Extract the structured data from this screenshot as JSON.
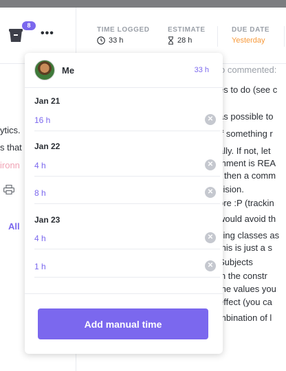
{
  "header": {
    "badge_count": "8",
    "more_label": "•••",
    "time_logged": {
      "label": "TIME LOGGED",
      "value": "33 h"
    },
    "estimate": {
      "label": "ESTIMATE",
      "value": "28 h"
    },
    "due_date": {
      "label": "DUE DATE",
      "value": "Yesterday"
    }
  },
  "left_fragments": [
    "ytics.",
    "s that",
    "ironn"
  ],
  "all_link": "All",
  "comments": [
    {
      "text": "o commented:",
      "style": "grey"
    },
    {
      "text": "es to do (see c",
      "style": "normal"
    },
    {
      "text": "as possible to",
      "style": "normal"
    },
    {
      "text": "If something r",
      "style": "normal"
    },
    {
      "text": "ally. If not, let",
      "style": "normal"
    },
    {
      "text": "mment is REA",
      "style": "normal"
    },
    {
      "text": ") then a comm",
      "style": "normal"
    },
    {
      "text": "cision.",
      "style": "normal"
    },
    {
      "text": "ore :P (trackin",
      "style": "normal"
    },
    {
      "text": "would avoid th",
      "style": "normal"
    },
    {
      "text": "sing classes as",
      "style": "normal"
    },
    {
      "text": "this is just a s",
      "style": "normal"
    },
    {
      "text": "Subjects",
      "style": "normal"
    },
    {
      "text": "in the constr",
      "style": "normal"
    },
    {
      "text": "the values you",
      "style": "normal"
    },
    {
      "text": "effect (you ca",
      "style": "normal"
    },
    {
      "text": "mbination of l",
      "style": "normal"
    }
  ],
  "popover": {
    "user": {
      "name": "Me",
      "total": "33 h"
    },
    "groups": [
      {
        "date": "Jan 21",
        "entries": [
          {
            "time": "16 h"
          }
        ]
      },
      {
        "date": "Jan 22",
        "entries": [
          {
            "time": "4 h"
          },
          {
            "time": "8 h"
          }
        ]
      },
      {
        "date": "Jan 23",
        "entries": [
          {
            "time": "4 h"
          },
          {
            "time": "1 h"
          }
        ]
      }
    ],
    "add_button": "Add manual time"
  },
  "colors": {
    "accent": "#7b68ee",
    "due_date": "#f79a3b",
    "remove_icon": "#c5c8cf"
  }
}
